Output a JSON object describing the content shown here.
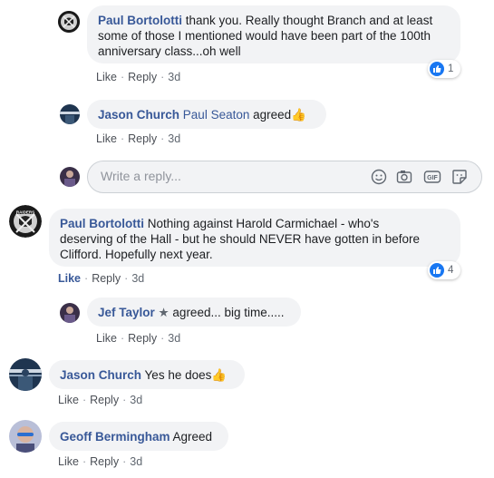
{
  "comments": [
    {
      "author": "Paul Bortolotti",
      "text": "thank you. Really thought Branch and at least some of those I mentioned would have been part of the 100th anniversary class...oh well",
      "line1": "thank you. Really thought Branch and at least",
      "line2": "some of those I mentioned would have been part of the 100th",
      "line3": "anniversary class...oh well",
      "likes": "1",
      "like_label": "Like",
      "reply_label": "Reply",
      "time": "3d"
    },
    {
      "author": "Jason Church",
      "mention": "Paul Seaton",
      "text": "agreed",
      "emoji": "👍",
      "like_label": "Like",
      "reply_label": "Reply",
      "time": "3d"
    },
    {
      "author": "Paul Bortolotti",
      "line1": "Nothing against Harold Carmichael - who's",
      "line2": "deserving of the Hall - but he should NEVER have gotten in before",
      "line3": "Clifford. Hopefully next year.",
      "likes": "4",
      "like_label": "Like",
      "reply_label": "Reply",
      "time": "3d"
    },
    {
      "author": "Jef Taylor",
      "star": "★",
      "text": "agreed... big time.....",
      "like_label": "Like",
      "reply_label": "Reply",
      "time": "3d"
    },
    {
      "author": "Jason Church",
      "text": "Yes he does",
      "emoji": "👍",
      "like_label": "Like",
      "reply_label": "Reply",
      "time": "3d"
    },
    {
      "author": "Geoff Bermingham",
      "text": "Agreed",
      "like_label": "Like",
      "reply_label": "Reply",
      "time": "3d"
    }
  ],
  "reply_box": {
    "placeholder": "Write a reply..."
  },
  "colors": {
    "link": "#385898",
    "bubble": "#f2f3f5",
    "like_blue": "#1877f2"
  }
}
